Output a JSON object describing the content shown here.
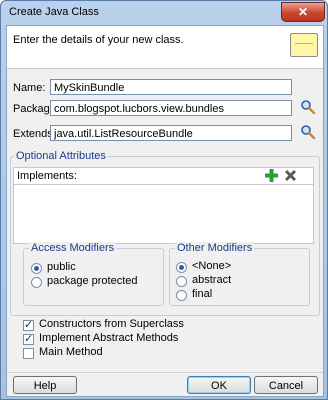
{
  "window": {
    "title": "Create Java Class",
    "close_glyph": "✕"
  },
  "header": {
    "instruction": "Enter the details of your new class.",
    "icon": "note-icon"
  },
  "fields": {
    "name": {
      "label": "Name:",
      "value": "MySkinBundle"
    },
    "package": {
      "label": "Package:",
      "value": "com.blogspot.lucbors.view.bundles",
      "icon": "search-icon"
    },
    "extends": {
      "label": "Extends:",
      "value": "java.util.ListResourceBundle",
      "icon": "search-icon"
    }
  },
  "optional": {
    "title": "Optional Attributes",
    "implements_label": "Implements:",
    "add_icon": "add-icon",
    "remove_icon": "remove-icon",
    "implements_items": []
  },
  "access_modifiers": {
    "title": "Access Modifiers",
    "options": [
      {
        "label": "public",
        "selected": true
      },
      {
        "label": "package protected",
        "selected": false
      }
    ]
  },
  "other_modifiers": {
    "title": "Other Modifiers",
    "options": [
      {
        "label": "<None>",
        "selected": true
      },
      {
        "label": "abstract",
        "selected": false
      },
      {
        "label": "final",
        "selected": false
      }
    ]
  },
  "checkboxes": [
    {
      "label": "Constructors from Superclass",
      "checked": true
    },
    {
      "label": "Implement Abstract Methods",
      "checked": true
    },
    {
      "label": "Main Method",
      "checked": false
    }
  ],
  "buttons": {
    "help": "Help",
    "ok": "OK",
    "cancel": "Cancel"
  },
  "colors": {
    "group_title": "#1a3c8c",
    "accent": "#2c5fa8",
    "add_green": "#2e9e2e"
  }
}
